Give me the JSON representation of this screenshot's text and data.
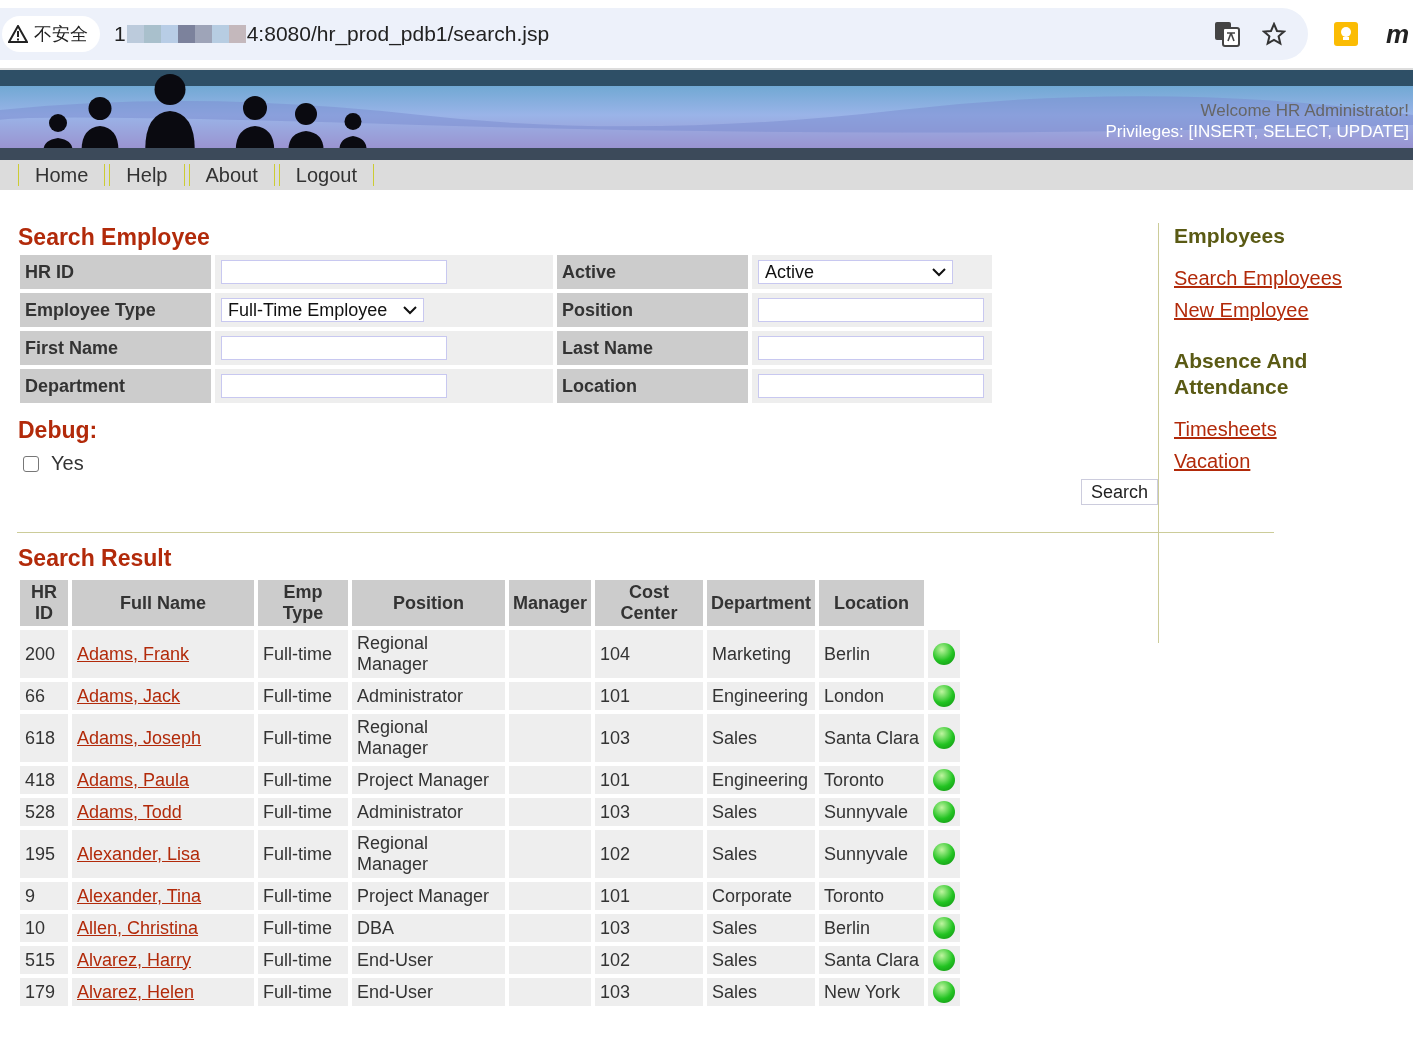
{
  "browser": {
    "security_label": "不安全",
    "url_start": "1",
    "url_end": "4:8080/hr_prod_pdb1/search.jsp",
    "extension_label": "m"
  },
  "header": {
    "welcome": "Welcome HR Administrator!",
    "privileges": "Privileges: [INSERT, SELECT, UPDATE]"
  },
  "nav": [
    "Home",
    "Help",
    "About",
    "Logout"
  ],
  "search": {
    "title": "Search Employee",
    "fields": [
      {
        "label": "HR ID",
        "kind": "input"
      },
      {
        "label": "Active",
        "kind": "select",
        "value": "Active"
      },
      {
        "label": "Employee Type",
        "kind": "select",
        "value": "Full-Time Employee"
      },
      {
        "label": "Position",
        "kind": "input"
      },
      {
        "label": "First Name",
        "kind": "input"
      },
      {
        "label": "Last Name",
        "kind": "input"
      },
      {
        "label": "Department",
        "kind": "input"
      },
      {
        "label": "Location",
        "kind": "input"
      }
    ],
    "debug_title": "Debug:",
    "debug_option": {
      "label": "Yes",
      "checked": false
    },
    "search_button": "Search"
  },
  "sidebar": {
    "sections": [
      {
        "title": "Employees",
        "links": [
          "Search Employees",
          "New Employee"
        ]
      },
      {
        "title": "Absence And Attendance",
        "links": [
          "Timesheets",
          "Vacation"
        ]
      }
    ]
  },
  "results": {
    "title": "Search Result",
    "columns": [
      "HR ID",
      "Full Name",
      "Emp Type",
      "Position",
      "Manager",
      "Cost Center",
      "Department",
      "Location"
    ],
    "rows": [
      {
        "hr_id": "200",
        "full_name": "Adams, Frank",
        "emp_type": "Full-time",
        "position": "Regional Manager",
        "manager": "",
        "cost_center": "104",
        "department": "Marketing",
        "location": "Berlin",
        "active": true
      },
      {
        "hr_id": "66",
        "full_name": "Adams, Jack",
        "emp_type": "Full-time",
        "position": "Administrator",
        "manager": "",
        "cost_center": "101",
        "department": "Engineering",
        "location": "London",
        "active": true
      },
      {
        "hr_id": "618",
        "full_name": "Adams, Joseph",
        "emp_type": "Full-time",
        "position": "Regional Manager",
        "manager": "",
        "cost_center": "103",
        "department": "Sales",
        "location": "Santa Clara",
        "active": true
      },
      {
        "hr_id": "418",
        "full_name": "Adams, Paula",
        "emp_type": "Full-time",
        "position": "Project Manager",
        "manager": "",
        "cost_center": "101",
        "department": "Engineering",
        "location": "Toronto",
        "active": true
      },
      {
        "hr_id": "528",
        "full_name": "Adams, Todd",
        "emp_type": "Full-time",
        "position": "Administrator",
        "manager": "",
        "cost_center": "103",
        "department": "Sales",
        "location": "Sunnyvale",
        "active": true
      },
      {
        "hr_id": "195",
        "full_name": "Alexander, Lisa",
        "emp_type": "Full-time",
        "position": "Regional Manager",
        "manager": "",
        "cost_center": "102",
        "department": "Sales",
        "location": "Sunnyvale",
        "active": true
      },
      {
        "hr_id": "9",
        "full_name": "Alexander, Tina",
        "emp_type": "Full-time",
        "position": "Project Manager",
        "manager": "",
        "cost_center": "101",
        "department": "Corporate",
        "location": "Toronto",
        "active": true
      },
      {
        "hr_id": "10",
        "full_name": "Allen, Christina",
        "emp_type": "Full-time",
        "position": "DBA",
        "manager": "",
        "cost_center": "103",
        "department": "Sales",
        "location": "Berlin",
        "active": true
      },
      {
        "hr_id": "515",
        "full_name": "Alvarez, Harry",
        "emp_type": "Full-time",
        "position": "End-User",
        "manager": "",
        "cost_center": "102",
        "department": "Sales",
        "location": "Santa Clara",
        "active": true
      },
      {
        "hr_id": "179",
        "full_name": "Alvarez, Helen",
        "emp_type": "Full-time",
        "position": "End-User",
        "manager": "",
        "cost_center": "103",
        "department": "Sales",
        "location": "New York",
        "active": true
      }
    ]
  }
}
